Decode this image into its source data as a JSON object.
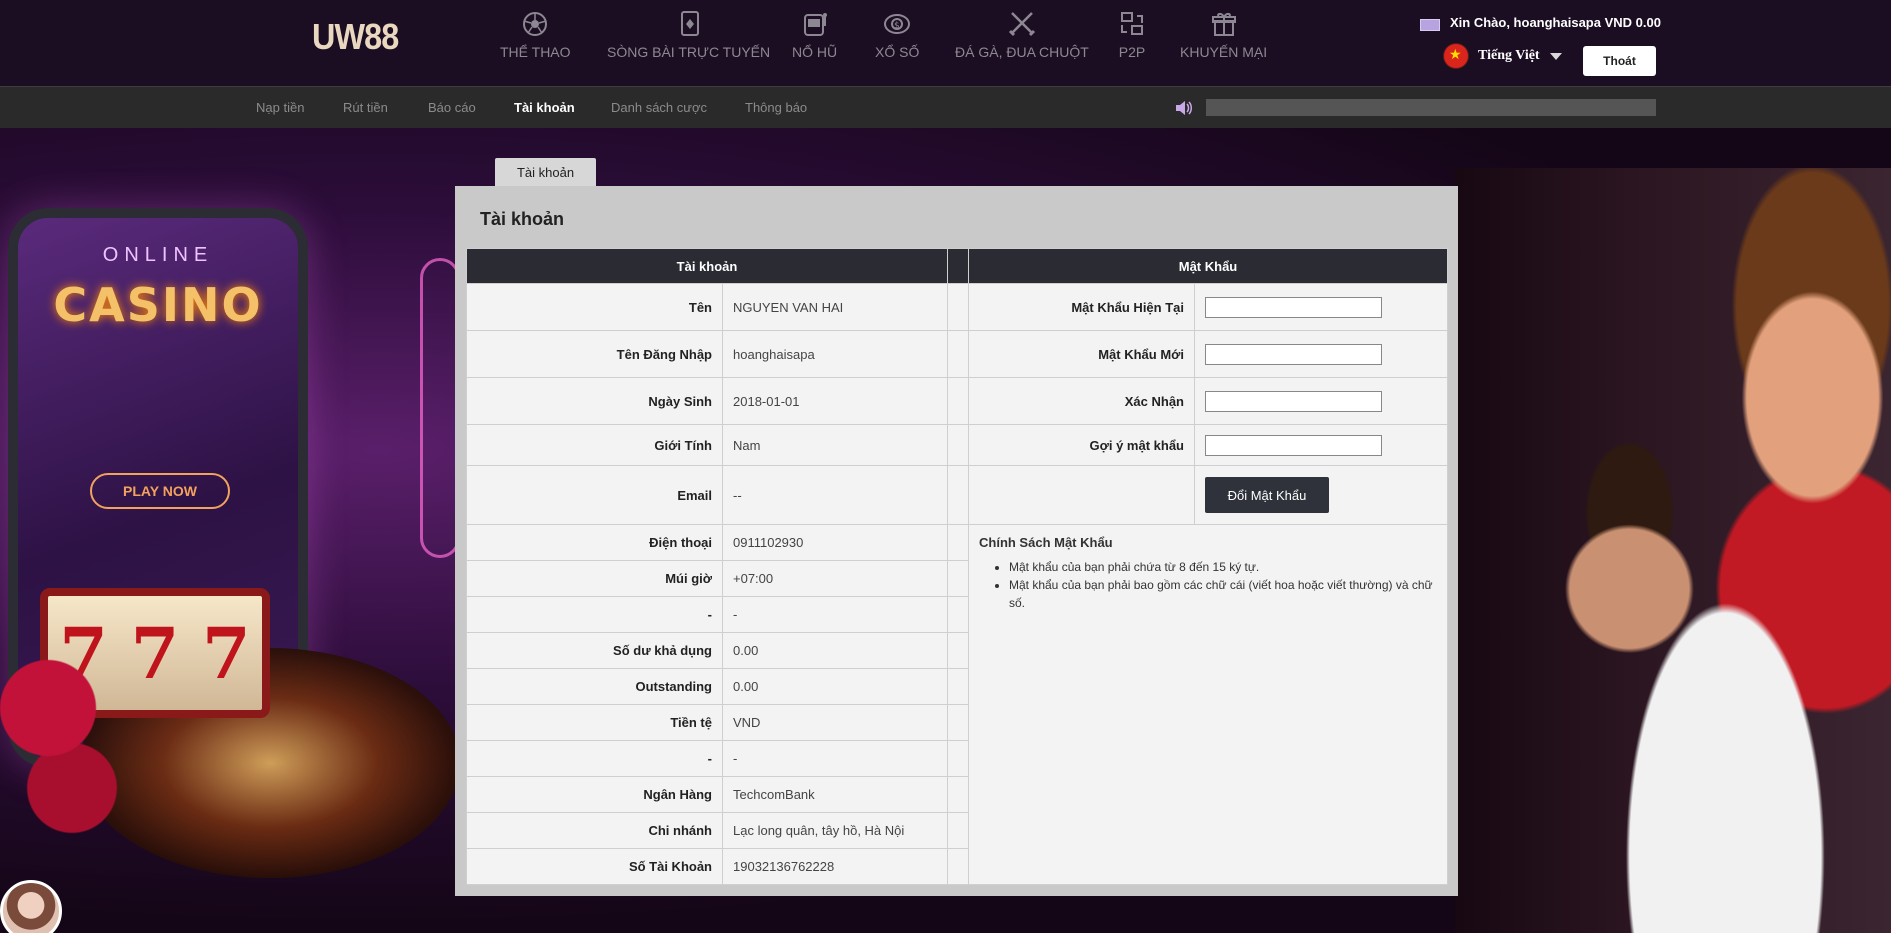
{
  "brand": {
    "logo": "UW88"
  },
  "nav": [
    {
      "label": "THỂ THAO",
      "icon": "soccer-ball-icon"
    },
    {
      "label": "SÒNG BÀI TRỰC TUYẾN",
      "icon": "playing-card-icon"
    },
    {
      "label": "NỔ HŨ",
      "icon": "slot-machine-icon"
    },
    {
      "label": "XỔ SỐ",
      "icon": "lottery-icon"
    },
    {
      "label": "ĐÁ GÀ, ĐUA CHUỘT",
      "icon": "crossed-swords-icon"
    },
    {
      "label": "P2P",
      "icon": "p2p-icon"
    },
    {
      "label": "KHUYẾN MẠI",
      "icon": "gift-icon"
    }
  ],
  "user": {
    "greeting": "Xin Chào, hoanghaisapa VND 0.00",
    "language": "Tiếng Việt",
    "logout": "Thoát"
  },
  "subnav": [
    {
      "label": "Nạp tiền",
      "active": false
    },
    {
      "label": "Rút tiền",
      "active": false
    },
    {
      "label": "Báo cáo",
      "active": false
    },
    {
      "label": "Tài khoản",
      "active": true
    },
    {
      "label": "Danh sách cược",
      "active": false
    },
    {
      "label": "Thông báo",
      "active": false
    }
  ],
  "banner": {
    "online": "ONLINE",
    "casino": "CASINO",
    "play_now": "PLAY NOW",
    "slot": [
      "7",
      "7",
      "7"
    ]
  },
  "account": {
    "tab_label": "Tài khoản",
    "title": "Tài khoản",
    "header_account": "Tài khoản",
    "header_password": "Mật Khẩu",
    "rows": [
      {
        "label": "Tên",
        "value": "NGUYEN VAN HAI"
      },
      {
        "label": "Tên Đăng Nhập",
        "value": "hoanghaisapa"
      },
      {
        "label": "Ngày Sinh",
        "value": "2018-01-01"
      },
      {
        "label": "Giới Tính",
        "value": "Nam"
      },
      {
        "label": "Email",
        "value": "--"
      },
      {
        "label": "Điện thoại",
        "value": "0911102930"
      },
      {
        "label": "Múi giờ",
        "value": "+07:00"
      },
      {
        "label": "-",
        "value": "-"
      },
      {
        "label": "Số dư khả dụng",
        "value": "0.00"
      },
      {
        "label": "Outstanding",
        "value": "0.00"
      },
      {
        "label": "Tiền tệ",
        "value": "VND"
      },
      {
        "label": "-",
        "value": "-"
      },
      {
        "label": "Ngân Hàng",
        "value": "TechcomBank"
      },
      {
        "label": "Chi nhánh",
        "value": "Lạc long quân, tây hồ, Hà Nội"
      },
      {
        "label": "Số Tài Khoản",
        "value": "19032136762228"
      }
    ],
    "password": {
      "current_label": "Mật Khẩu Hiện Tại",
      "new_label": "Mật Khẩu Mới",
      "confirm_label": "Xác Nhận",
      "hint_label": "Gợi ý mật khẩu",
      "current_value": "",
      "new_value": "",
      "confirm_value": "",
      "hint_value": "",
      "change_button": "Đổi Mật Khẩu"
    },
    "policy": {
      "title": "Chính Sách Mật Khẩu",
      "items": [
        "Mật khẩu của bạn phải chứa từ 8 đến 15 ký tự.",
        "Mật khẩu của bạn phải bao gồm các chữ cái (viết hoa hoặc viết thường) và chữ số."
      ]
    }
  },
  "colors": {
    "header_bg": "#1b0e22",
    "subnav_bg": "#2b2a2b",
    "table_header": "#2a2b33",
    "panel_bg": "#c9c9c9"
  }
}
